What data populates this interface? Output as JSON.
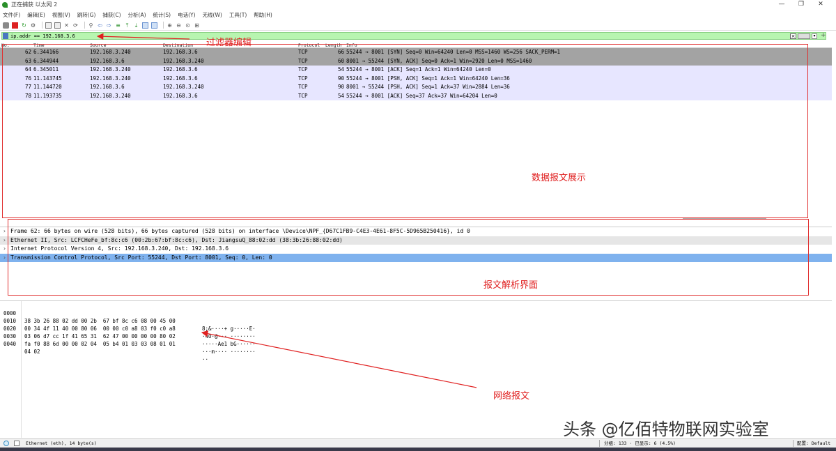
{
  "window": {
    "title": "正在捕获 以太网 2",
    "controls": [
      "—",
      "❐",
      "✕"
    ]
  },
  "menu": [
    "文件(F)",
    "编辑(E)",
    "视图(V)",
    "跳转(G)",
    "捕获(C)",
    "分析(A)",
    "统计(S)",
    "电话(Y)",
    "无线(W)",
    "工具(T)",
    "帮助(H)"
  ],
  "toolbar": {
    "icons": [
      "shark-fin-icon",
      "stop-capture-icon",
      "restart-capture-icon",
      "capture-options-icon",
      "open-file-icon",
      "save-file-icon",
      "close-file-icon",
      "reload-file-icon",
      "find-packet-icon",
      "go-back-icon",
      "go-forward-icon",
      "go-to-packet-icon",
      "go-first-icon",
      "go-last-icon",
      "auto-scroll-icon",
      "colorize-icon",
      "zoom-in-icon",
      "zoom-out-icon",
      "zoom-normal-icon",
      "resize-columns-icon"
    ]
  },
  "filter": {
    "value": "ip.addr == 192.168.3.6",
    "plus": "+"
  },
  "packet_list": {
    "columns": [
      "No.",
      "Time",
      "Source",
      "Destination",
      "Protocol",
      "Length",
      "Info"
    ],
    "rows": [
      {
        "no": "62",
        "time": "6.344166",
        "src": "192.168.3.240",
        "dst": "192.168.3.6",
        "proto": "TCP",
        "len": "66",
        "info": "55244 → 8001 [SYN] Seq=0 Win=64240 Len=0 MSS=1460 WS=256 SACK_PERM=1",
        "style": "syn"
      },
      {
        "no": "63",
        "time": "6.344944",
        "src": "192.168.3.6",
        "dst": "192.168.3.240",
        "proto": "TCP",
        "len": "60",
        "info": "8001 → 55244 [SYN, ACK] Seq=0 Ack=1 Win=2920 Len=0 MSS=1460",
        "style": "syn"
      },
      {
        "no": "64",
        "time": "6.345011",
        "src": "192.168.3.240",
        "dst": "192.168.3.6",
        "proto": "TCP",
        "len": "54",
        "info": "55244 → 8001 [ACK] Seq=1 Ack=1 Win=64240 Len=0",
        "style": "normal"
      },
      {
        "no": "76",
        "time": "11.143745",
        "src": "192.168.3.240",
        "dst": "192.168.3.6",
        "proto": "TCP",
        "len": "90",
        "info": "55244 → 8001 [PSH, ACK] Seq=1 Ack=1 Win=64240 Len=36",
        "style": "normal"
      },
      {
        "no": "77",
        "time": "11.144720",
        "src": "192.168.3.6",
        "dst": "192.168.3.240",
        "proto": "TCP",
        "len": "90",
        "info": "8001 → 55244 [PSH, ACK] Seq=1 Ack=37 Win=2884 Len=36",
        "style": "normal"
      },
      {
        "no": "78",
        "time": "11.193735",
        "src": "192.168.3.240",
        "dst": "192.168.3.6",
        "proto": "TCP",
        "len": "54",
        "info": "55244 → 8001 [ACK] Seq=37 Ack=37 Win=64204 Len=0",
        "style": "normal"
      }
    ]
  },
  "details": [
    "Frame 62: 66 bytes on wire (528 bits), 66 bytes captured (528 bits) on interface \\Device\\NPF_{D67C1FB9-C4E3-4E61-8F5C-5D965B250416}, id 0",
    "Ethernet II, Src: LCFCHeFe_bf:8c:c6 (00:2b:67:bf:8c:c6), Dst: JiangsuQ_88:02:dd (38:3b:26:88:02:dd)",
    "Internet Protocol Version 4, Src: 192.168.3.240, Dst: 192.168.3.6",
    "Transmission Control Protocol, Src Port: 55244, Dst Port: 8001, Seq: 0, Len: 0"
  ],
  "bytes": [
    {
      "offset": "0000",
      "hex": "38 3b 26 88 02 dd 00 2b  67 bf 8c c6 08 00 45 00",
      "ascii": "8;&····+ g·····E·"
    },
    {
      "offset": "0010",
      "hex": "00 34 4f 11 40 00 80 06  00 00 c0 a8 03 f0 c0 a8",
      "ascii": "·4O·@··· ········"
    },
    {
      "offset": "0020",
      "hex": "03 06 d7 cc 1f 41 65 31  62 47 00 00 00 00 80 02",
      "ascii": "·····Ae1 bG······"
    },
    {
      "offset": "0030",
      "hex": "fa f0 88 6d 00 00 02 04  05 b4 01 03 03 08 01 01",
      "ascii": "···m···· ········"
    },
    {
      "offset": "0040",
      "hex": "04 02",
      "ascii": "··"
    }
  ],
  "status": {
    "left": "Ethernet (eth), 14 byte(s)",
    "packets": "分组: 133 · 已显示: 6 (4.5%)",
    "profile": "配置: Default"
  },
  "annotations": {
    "filter_edit": "过滤器编辑",
    "packet_display": "数据报文展示",
    "packet_parse": "报文解析界面",
    "network_packet": "网络报文"
  },
  "watermark": "头条 @亿佰特物联网实验室",
  "colors": {
    "annotation": "#e02020",
    "filter_bg": "#b8f5b0",
    "syn_row": "#a3a3a3",
    "tcp_row": "#e7e6ff",
    "selected_detail": "#7fb2ee"
  }
}
